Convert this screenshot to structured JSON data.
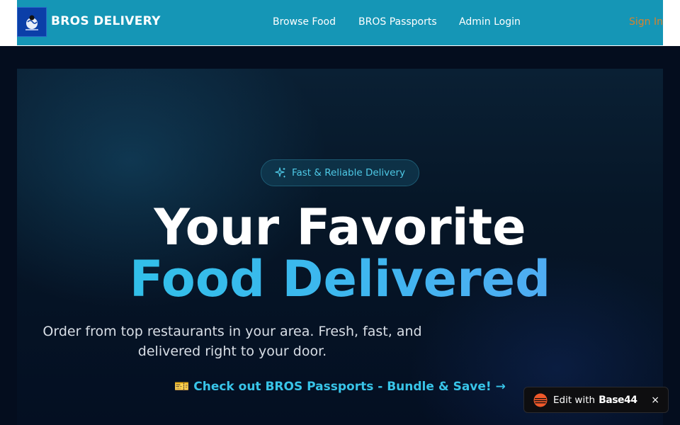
{
  "header": {
    "brand": "BROS DELIVERY",
    "nav": [
      "Browse Food",
      "BROS Passports",
      "Admin Login"
    ],
    "sign_in": "Sign In"
  },
  "hero": {
    "badge": "Fast & Reliable Delivery",
    "headline_line1": "Your Favorite",
    "headline_line2": "Food Delivered",
    "subtext": "Order from top restaurants in your area. Fresh, fast, and delivered right to your door.",
    "promo": "🎫 Check out BROS Passports - Bundle & Save! →"
  },
  "edit_widget": {
    "label": "Edit with",
    "brand": "Base44",
    "close": "×"
  },
  "colors": {
    "header_bg": "#1596b6",
    "sign_in": "#d9822b",
    "accent": "#38c4e8",
    "hero_bg": "#061627"
  }
}
